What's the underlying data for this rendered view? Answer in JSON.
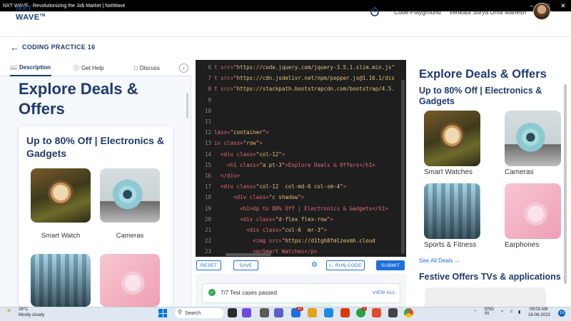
{
  "window": {
    "title": "NXT WAVE - Revolutionizing the Job Market | NxtWave"
  },
  "header": {
    "logo_line1": "NXT",
    "logo_line2": "WAVE",
    "logo_tm": "TM",
    "playground_label": "Code Playground",
    "user_name": "Venkata Surya Uma Mahesh"
  },
  "practice": {
    "title": "CODING PRACTICE 16"
  },
  "tabs": [
    {
      "label": "Description",
      "icon": "book-icon"
    },
    {
      "label": "Get Help",
      "icon": "help-icon"
    },
    {
      "label": "Discuss",
      "icon": "chat-icon"
    }
  ],
  "description": {
    "heading": "Explore Deals & Offers",
    "subheading": "Up to 80% Off | Electronics & Gadgets",
    "products": [
      "Smart Watch",
      "Cameras"
    ]
  },
  "editor": {
    "line_numbers": [
      "6",
      "7",
      "8",
      "9",
      "10",
      "11",
      "12",
      "13",
      "14",
      "15",
      "16",
      "17",
      "18",
      "19",
      "20",
      "21",
      "22",
      "23"
    ],
    "lines": [
      {
        "pre": "t src=",
        "str": "\"https://code.jquery.com/jquery-3.5.1.slim.min.js\""
      },
      {
        "pre": "t src=",
        "str": "\"https://cdn.jsdelivr.net/npm/popper.js@1.16.1/dis"
      },
      {
        "pre": "t src=",
        "str": "\"https://stackpath.bootstrapcdn.com/bootstrap/4.5."
      },
      {
        "pre": "",
        "str": ""
      },
      {
        "pre": "",
        "str": ""
      },
      {
        "pre": "",
        "str": ""
      },
      {
        "pre": "lass=",
        "str": "\"container\"",
        "post": ">"
      },
      {
        "pre": "iv class=",
        "str": "\"row\"",
        "post": ">"
      },
      {
        "pre": "  <div class=",
        "str": "\"col-12\"",
        "post": ">"
      },
      {
        "pre": "    <h1 class=",
        "str": "\"a pt-3\"",
        "post": ">Explore Deals & Offers</h1>"
      },
      {
        "pre": "  </div>",
        "str": ""
      },
      {
        "pre": "  <div class=",
        "str": "\"col-12  col-md-6 col-sm-4\"",
        "post": ">"
      },
      {
        "pre": "      <div class=",
        "str": "\"c shadow\"",
        "post": ">"
      },
      {
        "pre": "        <h1>Up to 80% Off | Electronics & Gadgets</h1>",
        "str": ""
      },
      {
        "pre": "        <div class=",
        "str": "\"d-flex flex-row\"",
        "post": ">"
      },
      {
        "pre": "          <div class=",
        "str": "\"col-6  mr-3\"",
        "post": ">"
      },
      {
        "pre": "            <img src=",
        "str": "\"https://d1tgh8fmlzexmh.cloud"
      },
      {
        "pre": "            <p>Smart Watches</p>",
        "str": ""
      }
    ]
  },
  "toolbar": {
    "reset": "RESET",
    "save": "SAVE",
    "run": "RUN CODE",
    "submit": "SUBMIT"
  },
  "result": {
    "text": "7/7 Test cases passed",
    "view_all": "VIEW ALL"
  },
  "preview": {
    "heading": "Explore Deals & Offers",
    "subheading": "Up to 80% Off | Electronics & Gadgets",
    "products": [
      "Smart Watches",
      "Cameras",
      "Sports & Fitness",
      "Earphones"
    ],
    "see_all": "See All Deals →",
    "festive": "Festive Offers TVs & applications"
  },
  "taskbar": {
    "temp": "28°C",
    "condition": "Mostly cloudy",
    "search": "Search",
    "lang1": "ENG",
    "lang2": "IN",
    "time": "09:03 AM",
    "date": "18-08-2023",
    "notif_count": "10",
    "badge1": "10",
    "badge2": "1"
  },
  "colors": {
    "brand": "#1e3a6e",
    "accent": "#1e6fd9",
    "success": "#2fa84f",
    "editor_bg": "#1e1e1e"
  }
}
